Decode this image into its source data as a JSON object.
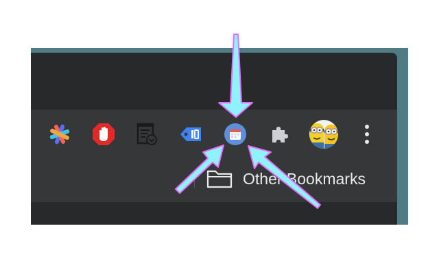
{
  "toolbar": {
    "extensions": [
      {
        "name": "pinwheel-extension",
        "icon": "pinwheel-icon"
      },
      {
        "name": "adblock-extension",
        "icon": "stop-hand-icon"
      },
      {
        "name": "form-document-extension",
        "icon": "document-check-icon"
      },
      {
        "name": "tag-extension",
        "icon": "blue-tag-icon"
      },
      {
        "name": "calendar-extension",
        "icon": "calendar-icon"
      },
      {
        "name": "extensions-menu",
        "icon": "puzzle-piece-icon"
      }
    ],
    "profile_avatar": "minion-avatar",
    "menu_icon": "three-dot-menu-icon"
  },
  "bookmarks_bar": {
    "folder_label": "Other Bookmarks",
    "folder_icon": "folder-icon"
  },
  "colors": {
    "toolbar_bg": "#363739",
    "titlebar_bg": "#28292b",
    "arrow_fill": "#8ff3ff",
    "arrow_outline": "#e66dff"
  }
}
